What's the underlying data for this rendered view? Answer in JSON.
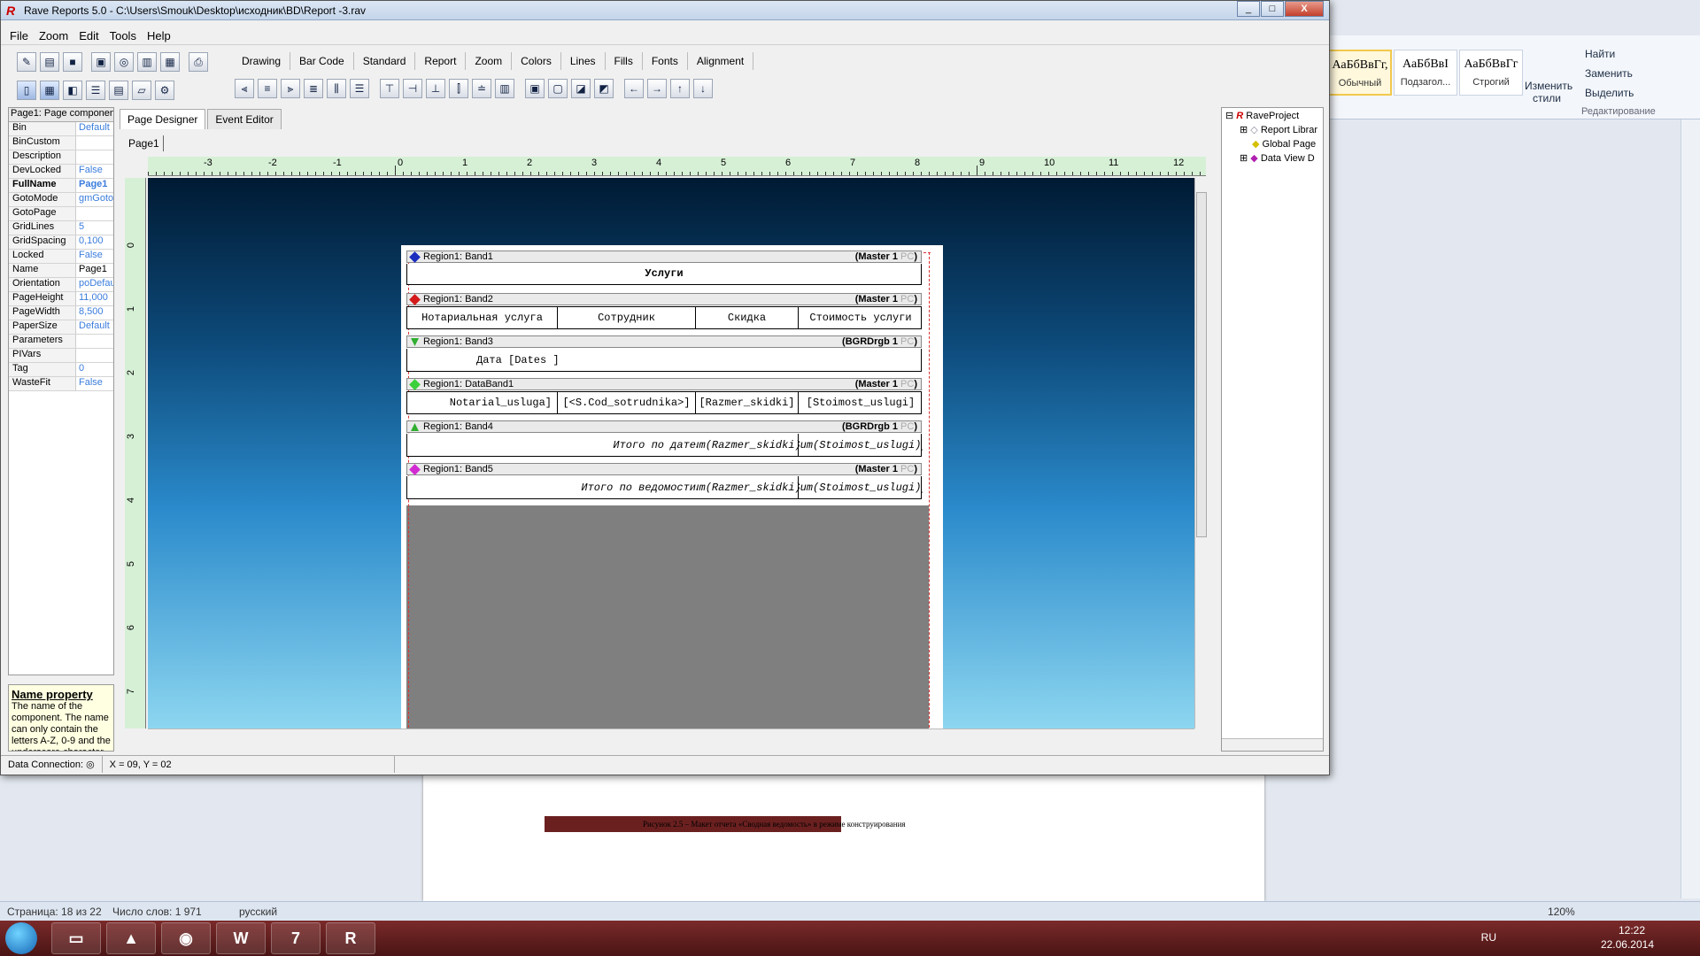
{
  "window": {
    "title": "Rave Reports 5.0 - C:\\Users\\Smouk\\Desktop\\исходник\\BD\\Report -3.rav",
    "buttons": [
      "_",
      "□",
      "X"
    ]
  },
  "menu": [
    "File",
    "Zoom",
    "Edit",
    "Tools",
    "Help"
  ],
  "palette_tabs": [
    "Drawing",
    "Bar Code",
    "Standard",
    "Report",
    "Zoom",
    "Colors",
    "Lines",
    "Fills",
    "Fonts",
    "Alignment"
  ],
  "properties": {
    "header": "Page1: Page component",
    "rows": [
      {
        "k": "Bin",
        "v": "Default"
      },
      {
        "k": "BinCustom",
        "v": ""
      },
      {
        "k": "Description",
        "v": ""
      },
      {
        "k": "DevLocked",
        "v": "False"
      },
      {
        "k": "FullName",
        "v": "Page1"
      },
      {
        "k": "GotoMode",
        "v": "gmGoto"
      },
      {
        "k": "GotoPage",
        "v": ""
      },
      {
        "k": "GridLines",
        "v": "5"
      },
      {
        "k": "GridSpacing",
        "v": "0,100"
      },
      {
        "k": "Locked",
        "v": "False"
      },
      {
        "k": "Name",
        "v": "Page1"
      },
      {
        "k": "Orientation",
        "v": "poDefau"
      },
      {
        "k": "PageHeight",
        "v": "11,000"
      },
      {
        "k": "PageWidth",
        "v": "8,500"
      },
      {
        "k": "PaperSize",
        "v": "Default"
      },
      {
        "k": "Parameters",
        "v": ""
      },
      {
        "k": "PIVars",
        "v": ""
      },
      {
        "k": "Tag",
        "v": "0"
      },
      {
        "k": "WasteFit",
        "v": "False"
      }
    ],
    "help_title": "Name property",
    "help_text": "The name of the component. The name can only contain the letters A-Z, 0-9 and the underscore character"
  },
  "designer": {
    "tabs": [
      "Page Designer",
      "Event Editor"
    ],
    "page_tab": "Page1",
    "ruler_h": [
      "-3",
      "-2",
      "-1",
      "0",
      "1",
      "2",
      "3",
      "4",
      "5",
      "6",
      "7",
      "8",
      "9",
      "10",
      "11",
      "12"
    ],
    "ruler_v": [
      "0",
      "1",
      "2",
      "3",
      "4",
      "5",
      "6",
      "7"
    ],
    "bands": [
      {
        "name": "Region1: Band1",
        "right": "(Master 1",
        "dim": "PC",
        "end": ")",
        "color": "#1a2dbf"
      },
      {
        "name": "Region1: Band2",
        "right": "(Master 1",
        "dim": "PC",
        "end": ")",
        "color": "#d41a1a"
      },
      {
        "name": "Region1: Band3",
        "right": "(BGRDrgb 1",
        "dim": "PC",
        "end": ")",
        "color": "#2fae2f"
      },
      {
        "name": "Region1: DataBand1",
        "right": "(Master 1",
        "dim": "PC",
        "end": ")",
        "color": "#3ccf3c"
      },
      {
        "name": "Region1: Band4",
        "right": "(BGRDrgb 1",
        "dim": "PC",
        "end": ")",
        "color": "#2fae2f"
      },
      {
        "name": "Region1: Band5",
        "right": "(Master 1",
        "dim": "PC",
        "end": ")",
        "color": "#d22ad2"
      }
    ],
    "title_text": "Услуги",
    "headers": [
      "Нотариальная услуга",
      "Сотрудник",
      "Скидка",
      "Стоимость услуги"
    ],
    "date_label": "Дата",
    "date_field": "[Dates      ]",
    "data_row": [
      "Notarial_usluga]",
      "[<S.Cod_sotrudnika>]",
      "[Razmer_skidki]",
      "[Stoimost_uslugi]"
    ],
    "sum_date": [
      "Итого по дате",
      "Sum(Razmer_skidki)]",
      "Sum(Stoimost_uslugi)]"
    ],
    "sum_all": [
      "Итого по ведомости",
      "Sum(Razmer_skidki)]",
      "Sum(Stoimost_uslugi)]"
    ]
  },
  "tree": {
    "root": "RaveProject",
    "items": [
      "Report Librar",
      "Global Page",
      "Data View D"
    ]
  },
  "status": {
    "conn": "Data Connection:",
    "coords": "X = 09, Y = 02"
  },
  "word": {
    "styles": [
      {
        "txt": "АаБбВвГг,",
        "lbl": "Обычный"
      },
      {
        "txt": "АаБбВвI",
        "lbl": "Подзагол..."
      },
      {
        "txt": "АаБбВвГг",
        "lbl": "Строгий"
      }
    ],
    "change_styles": "Изменить стили",
    "find": "Найти",
    "replace": "Заменить",
    "select": "Выделить",
    "editing": "Редактирование",
    "caption": "Рисунок 2.5 – Макет отчета «Сводная ведомость» в режиме конструирования",
    "page_info": "Страница: 18 из 22",
    "words": "Число слов: 1 971",
    "lang": "русский",
    "zoom": "120%"
  },
  "taskbar": {
    "lang": "RU",
    "time": "12:22",
    "date": "22.06.2014"
  }
}
